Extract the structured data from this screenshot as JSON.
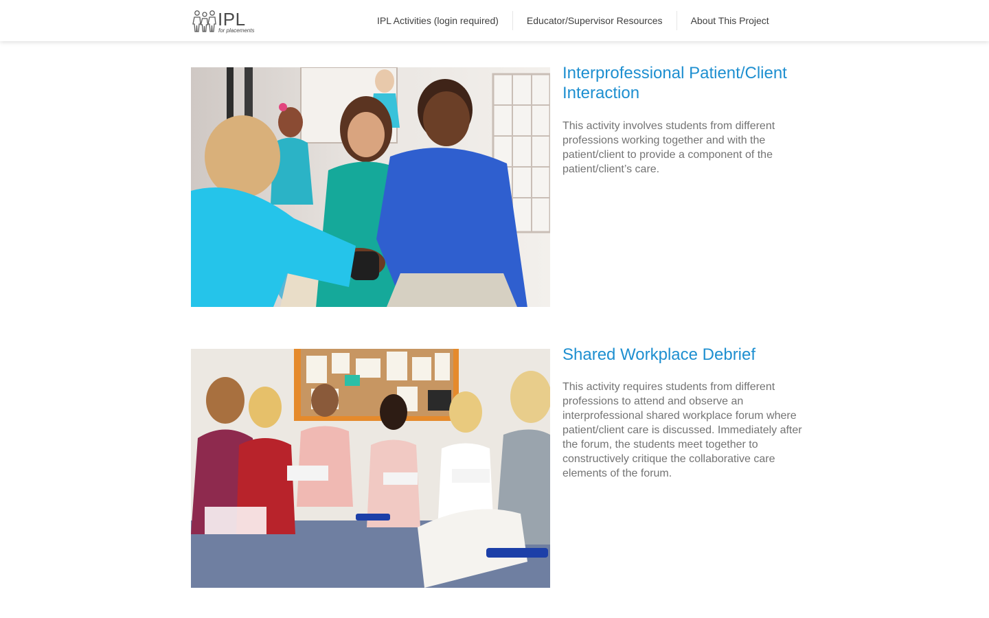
{
  "header": {
    "logo": {
      "icon": "people-figures-icon",
      "text": "IPL",
      "subtext": "for placements"
    },
    "nav": [
      {
        "label": "IPL Activities (login required)"
      },
      {
        "label": "Educator/Supervisor Resources"
      },
      {
        "label": "About This Project"
      }
    ]
  },
  "activities": [
    {
      "title": "Interprofessional Patient/Client Interaction",
      "description": "This activity involves students from different professions working together and with the patient/client to provide a component of the patient/client’s care.",
      "image": "photo-students-with-patient"
    },
    {
      "title": "Shared Workplace Debrief",
      "description": "This activity requires students from different professions to attend and observe an interprofessional shared workplace forum where patient/client care is discussed. Immediately after the forum, the students meet together to constructively critique the collaborative care elements of the forum.",
      "image": "photo-students-group-discussion"
    }
  ],
  "colors": {
    "accent": "#1e8fd0",
    "body_text": "#737373",
    "nav_text": "#3e3e3e"
  }
}
